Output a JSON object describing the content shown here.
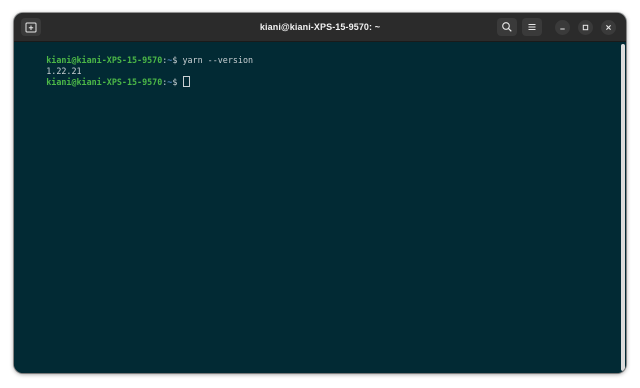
{
  "window": {
    "title": "kiani@kiani-XPS-15-9570: ~"
  },
  "header_buttons": {
    "new_tab_icon": "new-tab-icon",
    "search_icon": "search-icon",
    "menu_icon": "hamburger-menu-icon",
    "minimize_icon": "minimize-icon",
    "maximize_icon": "maximize-icon",
    "close_icon": "close-icon"
  },
  "terminal": {
    "lines": [
      {
        "prompt_user": "kiani@kiani-XPS-15-9570",
        "prompt_sep": ":",
        "prompt_path": "~",
        "prompt_symbol": "$ ",
        "command": "yarn --version"
      },
      {
        "output": "1.22.21"
      },
      {
        "prompt_user": "kiani@kiani-XPS-15-9570",
        "prompt_sep": ":",
        "prompt_path": "~",
        "prompt_symbol": "$ ",
        "command": ""
      }
    ]
  },
  "colors": {
    "terminal_background": "#022a34",
    "prompt_user": "#4cb847",
    "prompt_path": "#6a9be3",
    "text": "#c9d0d3",
    "titlebar": "#2b2b2b"
  }
}
